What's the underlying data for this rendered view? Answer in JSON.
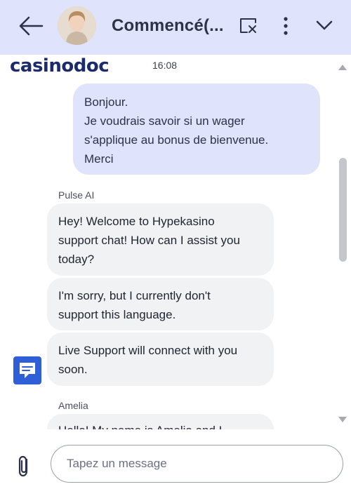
{
  "header": {
    "title": "Commencé(...",
    "icons": {
      "back": "arrow-left-icon",
      "end_chat": "end-chat-icon",
      "more": "more-vertical-icon",
      "collapse": "chevron-down-icon"
    },
    "background": "#dfe3fb"
  },
  "brand": {
    "logo_text": "casinodoc",
    "logo_color": "#1b2b6b",
    "accent": "#2f7ad6"
  },
  "chat": {
    "time": "16:08",
    "user_message": {
      "lines": [
        "Bonjour.",
        "Je voudrais savoir si un wager",
        "s'applique au bonus de bienvenue.",
        "Merci"
      ]
    },
    "bot_sender": "Pulse AI",
    "bot_messages": [
      {
        "lines": [
          "Hey! Welcome to Hypekasino",
          "support chat! How can I assist you",
          "today?"
        ]
      },
      {
        "lines": [
          "I'm sorry, but I currently don't",
          "support this language."
        ]
      },
      {
        "lines": [
          "Live Support will connect with you",
          "soon."
        ]
      }
    ],
    "agent_sender": "Amelia",
    "agent_message_partial": "Hello! My name is Amelia and I",
    "agent_icon": "chat-bubble-icon"
  },
  "composer": {
    "placeholder": "Tapez un message",
    "attach_icon": "paperclip-icon"
  },
  "colors": {
    "user_bubble": "#dfe3fb",
    "bot_bubble": "#f1f2f4",
    "agent_icon": "#2f5fd6"
  }
}
